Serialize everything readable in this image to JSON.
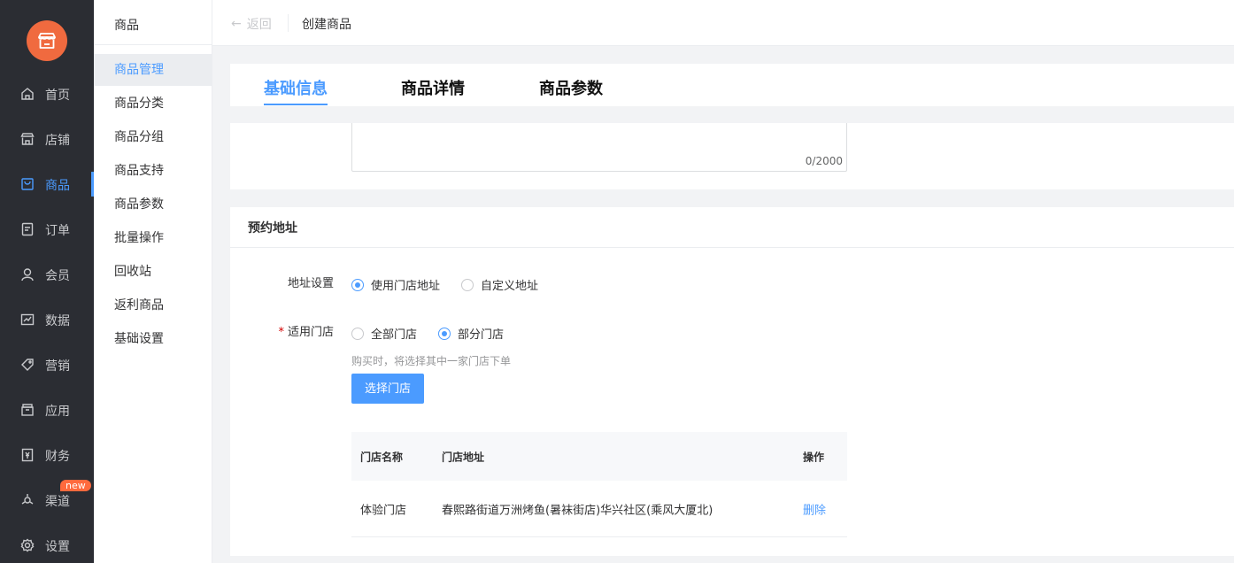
{
  "nav": {
    "items": [
      {
        "label": "首页",
        "icon": "home-icon"
      },
      {
        "label": "店铺",
        "icon": "store-icon"
      },
      {
        "label": "商品",
        "icon": "goods-icon",
        "active": true
      },
      {
        "label": "订单",
        "icon": "order-icon"
      },
      {
        "label": "会员",
        "icon": "member-icon"
      },
      {
        "label": "数据",
        "icon": "chart-icon"
      },
      {
        "label": "营销",
        "icon": "tag-icon"
      },
      {
        "label": "应用",
        "icon": "app-icon"
      },
      {
        "label": "财务",
        "icon": "finance-icon"
      },
      {
        "label": "渠道",
        "icon": "channel-icon",
        "badge": "new"
      },
      {
        "label": "设置",
        "icon": "gear-icon"
      }
    ]
  },
  "submenu": {
    "title": "商品",
    "items": [
      "商品管理",
      "商品分类",
      "商品分组",
      "商品支持",
      "商品参数",
      "批量操作",
      "回收站",
      "返利商品",
      "基础设置"
    ]
  },
  "topbar": {
    "back": "返回",
    "crumb": "创建商品"
  },
  "tabs": [
    "基础信息",
    "商品详情",
    "商品参数"
  ],
  "textarea": {
    "counter": "0/2000"
  },
  "address": {
    "title": "预约地址",
    "address_setting_label": "地址设置",
    "address_options": [
      "使用门店地址",
      "自定义地址"
    ],
    "store_label": "适用门店",
    "store_options": [
      "全部门店",
      "部分门店"
    ],
    "hint": "购买时，将选择其中一家门店下单",
    "select_button": "选择门店",
    "table": {
      "headers": [
        "门店名称",
        "门店地址",
        "操作"
      ],
      "rows": [
        {
          "name": "体验门店",
          "address": "春熙路街道万洲烤鱼(暑袜街店)华兴社区(乘风大厦北)",
          "action": "删除"
        }
      ]
    }
  },
  "colors": {
    "accent": "#4b9bff",
    "nav_bg": "#2b2d33",
    "logo": "#f06a3f",
    "badge": "#ff6a3d"
  }
}
